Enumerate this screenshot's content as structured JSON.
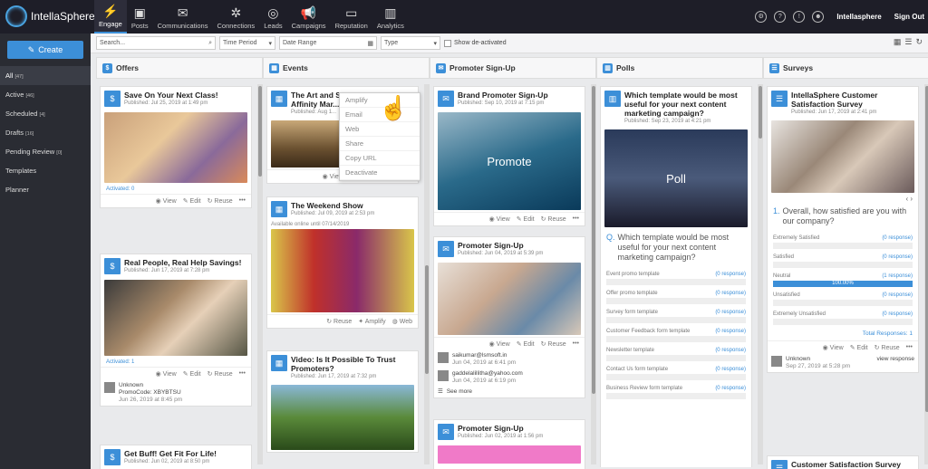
{
  "app": {
    "name": "IntellaSphere"
  },
  "nav": [
    {
      "label": "Engage",
      "icon": "engage-icon"
    },
    {
      "label": "Posts",
      "icon": "posts-icon"
    },
    {
      "label": "Communications",
      "icon": "communications-icon"
    },
    {
      "label": "Connections",
      "icon": "connections-icon"
    },
    {
      "label": "Leads",
      "icon": "leads-icon"
    },
    {
      "label": "Campaigns",
      "icon": "campaigns-icon"
    },
    {
      "label": "Reputation",
      "icon": "reputation-icon"
    },
    {
      "label": "Analytics",
      "icon": "analytics-icon"
    }
  ],
  "top_right": {
    "account": "Intellasphere",
    "signout": "Sign Out"
  },
  "sidebar": {
    "create": "Create",
    "items": [
      {
        "label": "All",
        "count": "[47]"
      },
      {
        "label": "Active",
        "count": "[46]"
      },
      {
        "label": "Scheduled",
        "count": "[4]"
      },
      {
        "label": "Drafts",
        "count": "[16]"
      },
      {
        "label": "Pending Review",
        "count": "[0]"
      },
      {
        "label": "Templates",
        "count": ""
      },
      {
        "label": "Planner",
        "count": ""
      }
    ]
  },
  "filters": {
    "search_placeholder": "Search...",
    "time_period": "Time Period",
    "date_range": "Date Range",
    "type": "Type",
    "show_deactivated": "Show de-activated"
  },
  "columns": {
    "offers": "Offers",
    "events": "Events",
    "promoter": "Promoter Sign-Up",
    "polls": "Polls",
    "surveys": "Surveys"
  },
  "actions": {
    "view": "View",
    "edit": "Edit",
    "reuse": "Reuse",
    "amplify": "Amplify",
    "web": "Web",
    "more": "•••"
  },
  "offers": [
    {
      "title": "Save On Your Next Class!",
      "meta": "Published: Jul 25, 2019 at 1:49 pm",
      "activated": "Activated: 0"
    },
    {
      "title": "Real People, Real Help Savings!",
      "meta": "Published: Jun 17, 2019 at 7:28 pm",
      "activated": "Activated: 1",
      "contact_name": "Unknown",
      "contact_code": "PromoCode: XBYBTSU",
      "contact_date": "Jun 26, 2019 at 8:45 pm"
    },
    {
      "title": "Get Buff! Get Fit For Life!",
      "meta": "Published: Jun 02, 2019 at 8:50 pm"
    }
  ],
  "events": [
    {
      "title": "The Art and Science of Brand Affinity Mar...",
      "meta": "Published: Aug 1..."
    },
    {
      "title": "The Weekend Show",
      "meta": "Published: Jul 09, 2019 at 2:53 pm",
      "note": "Available online until 07/14/2019"
    },
    {
      "title": "Video: Is It Possible To Trust Promoters?",
      "meta": "Published: Jun 17, 2019 at 7:32 pm"
    }
  ],
  "context_menu": [
    "Amplify",
    "Email",
    "Web",
    "Share",
    "Copy URL",
    "Deactivate"
  ],
  "promoter": [
    {
      "title": "Brand Promoter Sign-Up",
      "meta": "Published: Sep 10, 2019 at 7:15 pm",
      "image_text": "Promote"
    },
    {
      "title": "Promoter Sign-Up",
      "meta": "Published: Jun 04, 2019 at 5:39 pm",
      "contacts": [
        {
          "email": "saikumar@lsmsoft.in",
          "date": "Jun 04, 2019 at 6:41 pm"
        },
        {
          "email": "gaddelalillitha@yahoo.com",
          "date": "Jun 04, 2019 at 6:19 pm"
        }
      ],
      "see_more": "See more"
    },
    {
      "title": "Promoter Sign-Up",
      "meta": "Published: Jun 02, 2019 at 1:56 pm"
    }
  ],
  "poll": {
    "title": "Which template would be most useful for your next content marketing campaign?",
    "meta": "Published: Sep 23, 2019 at 4:21 pm",
    "image_text": "Poll",
    "question_mark": "Q.",
    "question": "Which template would be most useful for your next content marketing campaign?",
    "options": [
      "Event promo template",
      "Offer promo template",
      "Survey form template",
      "Customer Feedback form template",
      "Newsletter template",
      "Contact Us form template",
      "Business Review form template"
    ],
    "response": "(0 response)"
  },
  "survey": {
    "title": "IntellaSphere Customer Satisfaction Survey",
    "meta": "Published: Jun 17, 2019 at 2:41 pm",
    "question_num": "1.",
    "question": "Overall, how satisfied are you with our company?",
    "options": [
      {
        "label": "Extremely Satisfied",
        "resp": "(0 response)"
      },
      {
        "label": "Satisfied",
        "resp": "(0 response)"
      },
      {
        "label": "Neutral",
        "resp": "(1 response)",
        "pct": "100.00%"
      },
      {
        "label": "Unsatisfied",
        "resp": "(0 response)"
      },
      {
        "label": "Extremely Unsatisfied",
        "resp": "(0 response)"
      }
    ],
    "total": "Total Responses: 1",
    "contact": "Unknown",
    "contact_date": "Sep 27, 2019 at 5:28 pm",
    "view_response": "view response",
    "next_title": "Customer Satisfaction Survey"
  }
}
